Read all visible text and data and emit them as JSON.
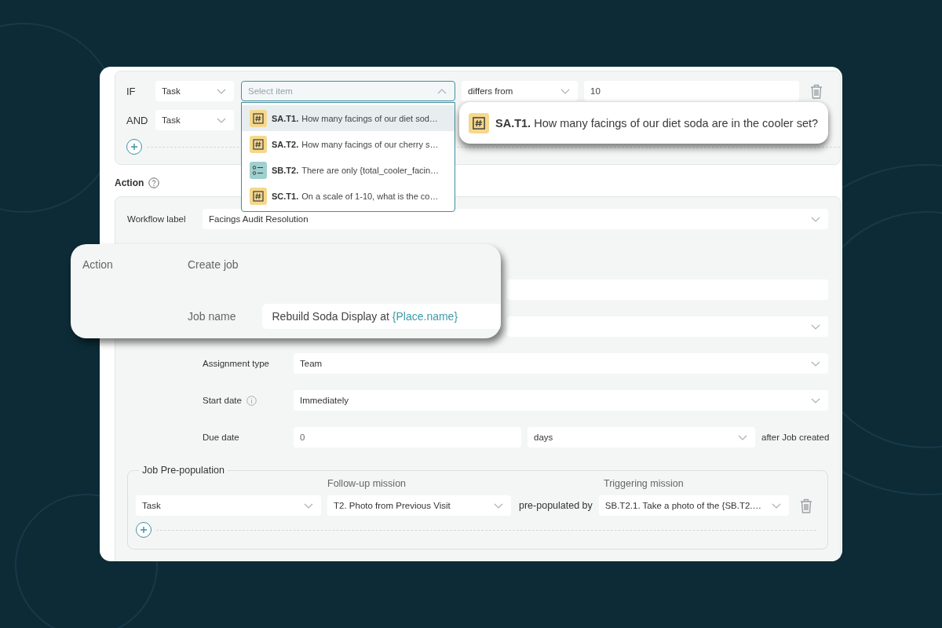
{
  "conditions": [
    {
      "operator": "IF",
      "type": "Task",
      "item": {
        "placeholder": "Select item",
        "expanded": true
      },
      "comparison": "differs from",
      "value": "10"
    },
    {
      "operator": "AND",
      "type": "Task"
    }
  ],
  "item_options": [
    {
      "code": "SA.T1.",
      "text": "How many facings of our diet sod…",
      "kind": "number",
      "selected": true
    },
    {
      "code": "SA.T2.",
      "text": "How many facings of our cherry s…",
      "kind": "number",
      "selected": false
    },
    {
      "code": "SB.T2.",
      "text": "There are only {total_cooler_facin…",
      "kind": "choice",
      "selected": false
    },
    {
      "code": "SC.T1.",
      "text": "On a scale of 1-10, what is the co…",
      "kind": "number",
      "selected": false
    }
  ],
  "item_preview": {
    "code": "SA.T1.",
    "text": "How many facings of our diet soda are in the cooler set?",
    "kind": "number"
  },
  "action_heading": "Action",
  "workflow": {
    "label": "Workflow label",
    "value": "Facings Audit Resolution"
  },
  "fields": [
    {
      "kind": "spacer"
    },
    {
      "kind": "text"
    },
    {
      "kind": "select"
    },
    {
      "kind": "select",
      "label": "Assignment type",
      "value": "Team"
    },
    {
      "kind": "select",
      "label": "Start date",
      "value": "Immediately",
      "info": true
    },
    {
      "kind": "due",
      "label": "Due date",
      "value": "0",
      "unit": "days",
      "suffix": "after Job created"
    }
  ],
  "prepopulation": {
    "legend": "Job Pre-population",
    "followup_header": "Follow-up mission",
    "triggering_header": "Triggering mission",
    "rows": [
      {
        "type": "Task",
        "followup": "T2. Photo from Previous Visit",
        "connector": "pre-populated by",
        "triggering": "SB.T2.1. Take a photo of the {SB.T2.…"
      }
    ]
  },
  "action_card": {
    "label": "Action",
    "value": "Create job",
    "job_label": "Job name",
    "job_value": "Rebuild Soda Display at ",
    "job_token": "{Place.name}"
  }
}
